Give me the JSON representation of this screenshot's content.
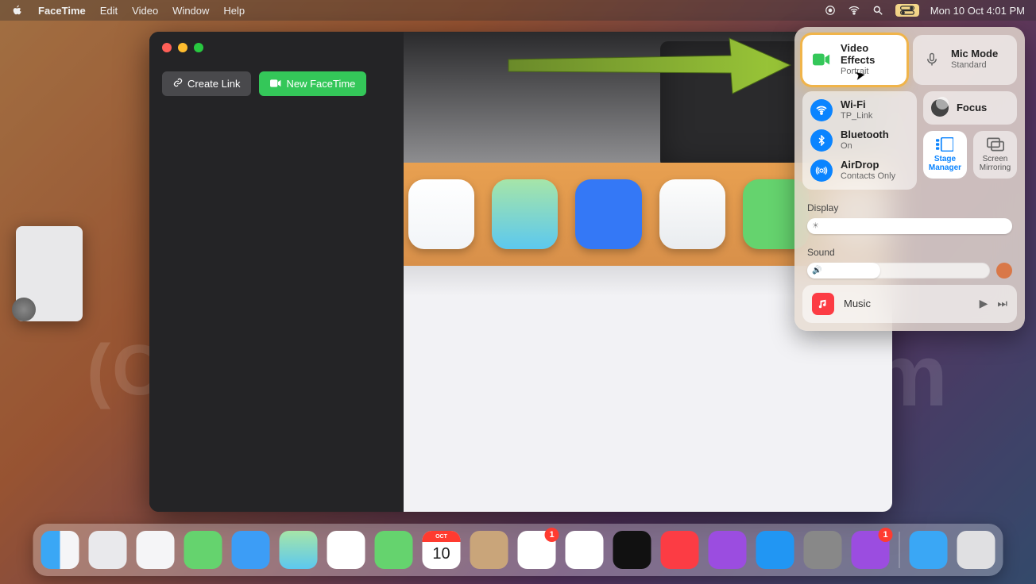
{
  "menubar": {
    "app": "FaceTime",
    "items": [
      "Edit",
      "Video",
      "Window",
      "Help"
    ],
    "datetime": "Mon 10 Oct  4:01 PM"
  },
  "facetime": {
    "create_link": "Create Link",
    "new_facetime": "New FaceTime"
  },
  "control_center": {
    "video_effects": {
      "title": "Video Effects",
      "sub": "Portrait"
    },
    "mic_mode": {
      "title": "Mic Mode",
      "sub": "Standard"
    },
    "wifi": {
      "title": "Wi-Fi",
      "sub": "TP_Link"
    },
    "bluetooth": {
      "title": "Bluetooth",
      "sub": "On"
    },
    "airdrop": {
      "title": "AirDrop",
      "sub": "Contacts Only"
    },
    "focus": {
      "title": "Focus"
    },
    "stage_manager": "Stage\nManager",
    "screen_mirroring": "Screen\nMirroring",
    "display_label": "Display",
    "sound_label": "Sound",
    "music_label": "Music"
  },
  "sliders": {
    "display_percent": 100,
    "sound_percent": 40
  },
  "dock": {
    "cal_month": "OCT",
    "cal_day": "10",
    "reminders_badge": "1",
    "clips_badge": "1"
  },
  "watermark": "howtoisolve.com"
}
